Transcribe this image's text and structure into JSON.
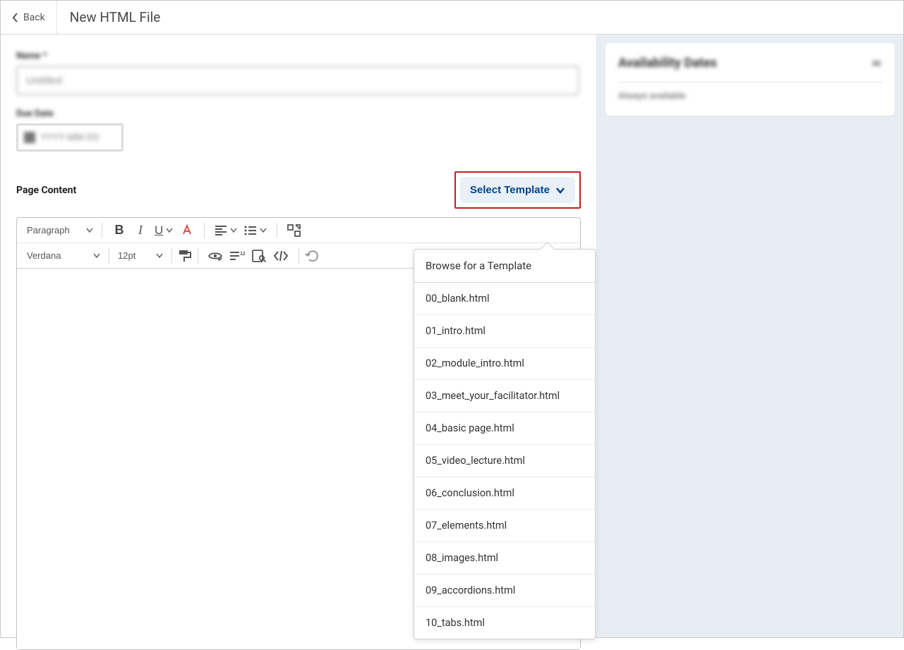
{
  "header": {
    "back_label": "Back",
    "title": "New HTML File"
  },
  "form": {
    "name_label": "Name *",
    "name_value": "Untitled",
    "due_label": "Due Date",
    "due_placeholder": "YYYY-MM-DD"
  },
  "page_content": {
    "label": "Page Content",
    "select_template_label": "Select Template"
  },
  "editor_toolbar": {
    "block_format": "Paragraph",
    "font_family": "Verdana",
    "font_size": "12pt"
  },
  "template_menu": {
    "browse_label": "Browse for a Template",
    "items": [
      "00_blank.html",
      "01_intro.html",
      "02_module_intro.html",
      "03_meet_your_facilitator.html",
      "04_basic page.html",
      "05_video_lecture.html",
      "06_conclusion.html",
      "07_elements.html",
      "08_images.html",
      "09_accordions.html",
      "10_tabs.html"
    ]
  },
  "sidebar": {
    "card_title": "Availability Dates",
    "card_sub": "Always available"
  }
}
